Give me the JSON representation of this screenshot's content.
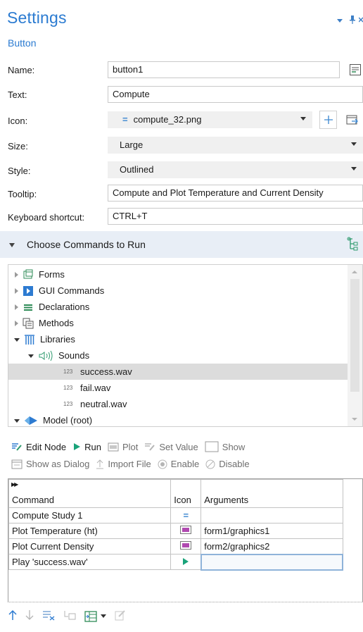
{
  "header": {
    "title": "Settings",
    "subtitle": "Button"
  },
  "form": {
    "name_label": "Name:",
    "name_value": "button1",
    "text_label": "Text:",
    "text_value": "Compute",
    "icon_label": "Icon:",
    "icon_value": "compute_32.png",
    "size_label": "Size:",
    "size_value": "Large",
    "style_label": "Style:",
    "style_value": "Outlined",
    "tooltip_label": "Tooltip:",
    "tooltip_value": "Compute and Plot Temperature and Current Density",
    "shortcut_label": "Keyboard shortcut:",
    "shortcut_value": "CTRL+T"
  },
  "section": {
    "title": "Choose Commands to Run"
  },
  "tree": {
    "items": [
      {
        "label": "Forms",
        "icon": "forms-icon"
      },
      {
        "label": "GUI Commands",
        "icon": "gui-commands-icon"
      },
      {
        "label": "Declarations",
        "icon": "declarations-icon"
      },
      {
        "label": "Methods",
        "icon": "methods-icon"
      },
      {
        "label": "Libraries",
        "icon": "libraries-icon"
      },
      {
        "label": "Sounds",
        "icon": "sounds-icon"
      },
      {
        "label": "success.wav",
        "icon": "123"
      },
      {
        "label": "fail.wav",
        "icon": "123"
      },
      {
        "label": "neutral.wav",
        "icon": "123"
      },
      {
        "label": "Model (root)",
        "icon": "model-icon"
      }
    ]
  },
  "toolbar": {
    "edit_node": "Edit Node",
    "run": "Run",
    "plot": "Plot",
    "set_value": "Set Value",
    "show": "Show",
    "show_as_dialog": "Show as Dialog",
    "import_file": "Import File",
    "enable": "Enable",
    "disable": "Disable"
  },
  "table": {
    "headers": {
      "command": "Command",
      "icon": "Icon",
      "arguments": "Arguments"
    },
    "rows": [
      {
        "command": "Compute Study 1",
        "icon": "compute-icon",
        "arguments": ""
      },
      {
        "command": "Plot Temperature (ht)",
        "icon": "plot-icon",
        "arguments": "form1/graphics1"
      },
      {
        "command": "Plot Current Density",
        "icon": "plot-icon",
        "arguments": "form2/graphics2"
      },
      {
        "command": "Play 'success.wav'",
        "icon": "play-icon",
        "arguments": ""
      }
    ]
  },
  "colors": {
    "accent": "#2b7bd1",
    "section_bg": "#e8eef6",
    "selected_row": "#dcdcdc",
    "run_green": "#1aa37a"
  }
}
